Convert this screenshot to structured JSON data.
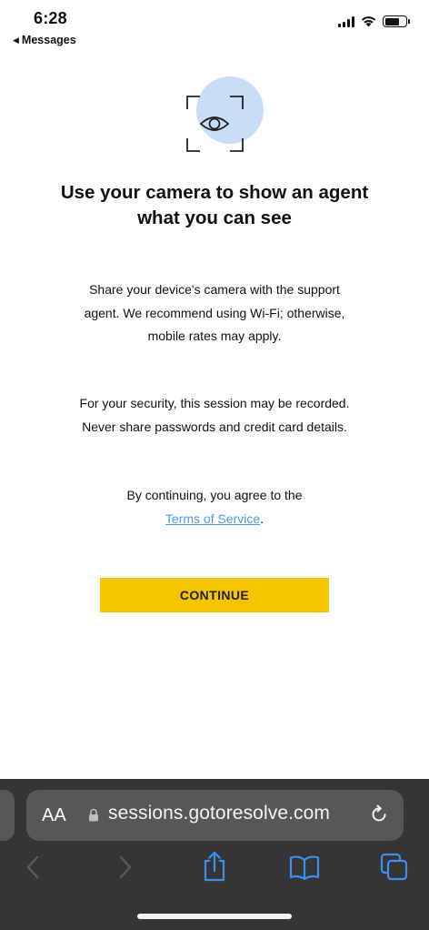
{
  "status_bar": {
    "time": "6:28",
    "back_app_label": "Messages"
  },
  "content": {
    "hero_icon": "camera-eye-icon",
    "title": "Use your camera to show an agent what you can see",
    "paragraph1": "Share your device's camera with the support agent. We recommend using Wi-Fi; otherwise, mobile rates may apply.",
    "paragraph2": "For your security, this session may be recorded. Never share passwords and credit card details.",
    "agree_prefix": "By continuing, you agree to the",
    "tos_link": "Terms of Service",
    "agree_suffix": ".",
    "continue_label": "CONTINUE"
  },
  "browser": {
    "aa_label": "AA",
    "url": "sessions.gotoresolve.com"
  },
  "colors": {
    "accent_button": "#f7c400",
    "link": "#4a9be0",
    "hero_circle": "#c9ddf7",
    "browser_chrome": "#353535",
    "toolbar_icon_active": "#3b8ff0",
    "toolbar_icon_disabled": "#5a5a5a"
  }
}
